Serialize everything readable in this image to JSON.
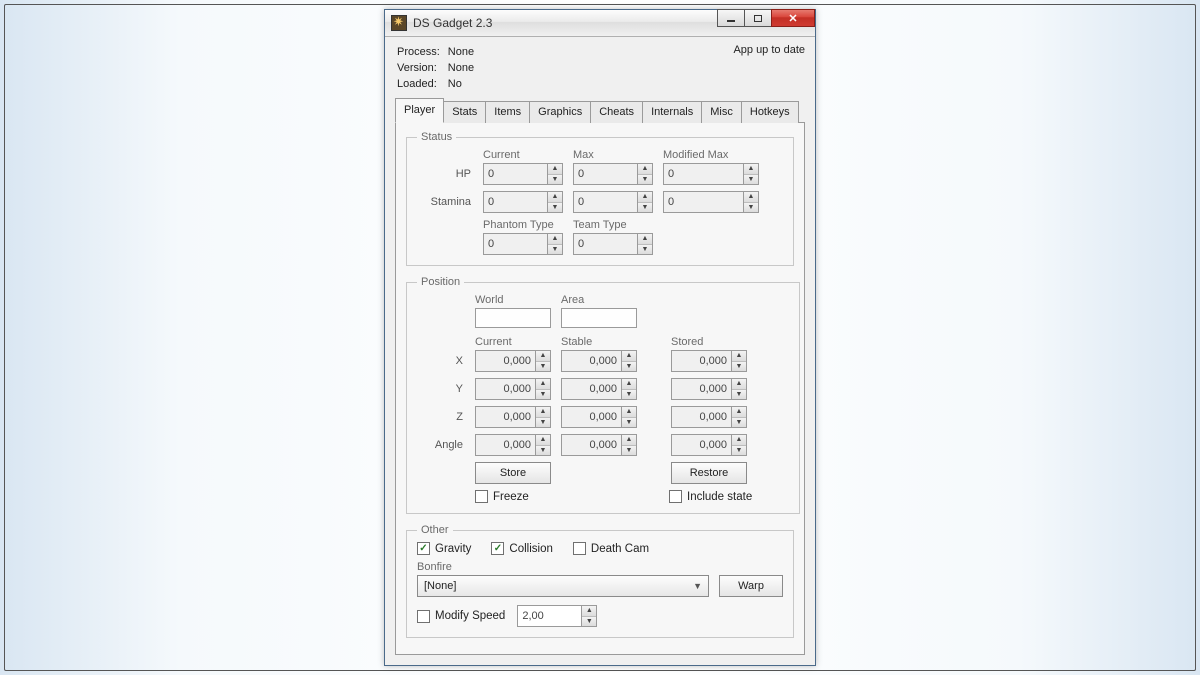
{
  "window": {
    "title": "DS Gadget 2.3",
    "status_text": "App up to date"
  },
  "info": {
    "process_label": "Process:",
    "process_value": "None",
    "version_label": "Version:",
    "version_value": "None",
    "loaded_label": "Loaded:",
    "loaded_value": "No"
  },
  "tabs": [
    "Player",
    "Stats",
    "Items",
    "Graphics",
    "Cheats",
    "Internals",
    "Misc",
    "Hotkeys"
  ],
  "status": {
    "legend": "Status",
    "col_current": "Current",
    "col_max": "Max",
    "col_modmax": "Modified Max",
    "hp_label": "HP",
    "stamina_label": "Stamina",
    "hp": {
      "current": "0",
      "max": "0",
      "modmax": "0"
    },
    "stamina": {
      "current": "0",
      "max": "0",
      "modmax": "0"
    },
    "phantom_label": "Phantom Type",
    "team_label": "Team Type",
    "phantom_value": "0",
    "team_value": "0"
  },
  "position": {
    "legend": "Position",
    "world_label": "World",
    "area_label": "Area",
    "world_value": "",
    "area_value": "",
    "col_current": "Current",
    "col_stable": "Stable",
    "col_stored": "Stored",
    "x_label": "X",
    "y_label": "Y",
    "z_label": "Z",
    "angle_label": "Angle",
    "x": {
      "current": "0,000",
      "stable": "0,000",
      "stored": "0,000"
    },
    "y": {
      "current": "0,000",
      "stable": "0,000",
      "stored": "0,000"
    },
    "z": {
      "current": "0,000",
      "stable": "0,000",
      "stored": "0,000"
    },
    "angle": {
      "current": "0,000",
      "stable": "0,000",
      "stored": "0,000"
    },
    "store_label": "Store",
    "restore_label": "Restore",
    "freeze_label": "Freeze",
    "include_state_label": "Include state"
  },
  "other": {
    "legend": "Other",
    "gravity_label": "Gravity",
    "collision_label": "Collision",
    "deathcam_label": "Death Cam",
    "bonfire_label": "Bonfire",
    "bonfire_value": "[None]",
    "warp_label": "Warp",
    "modify_speed_label": "Modify Speed",
    "speed_value": "2,00"
  }
}
